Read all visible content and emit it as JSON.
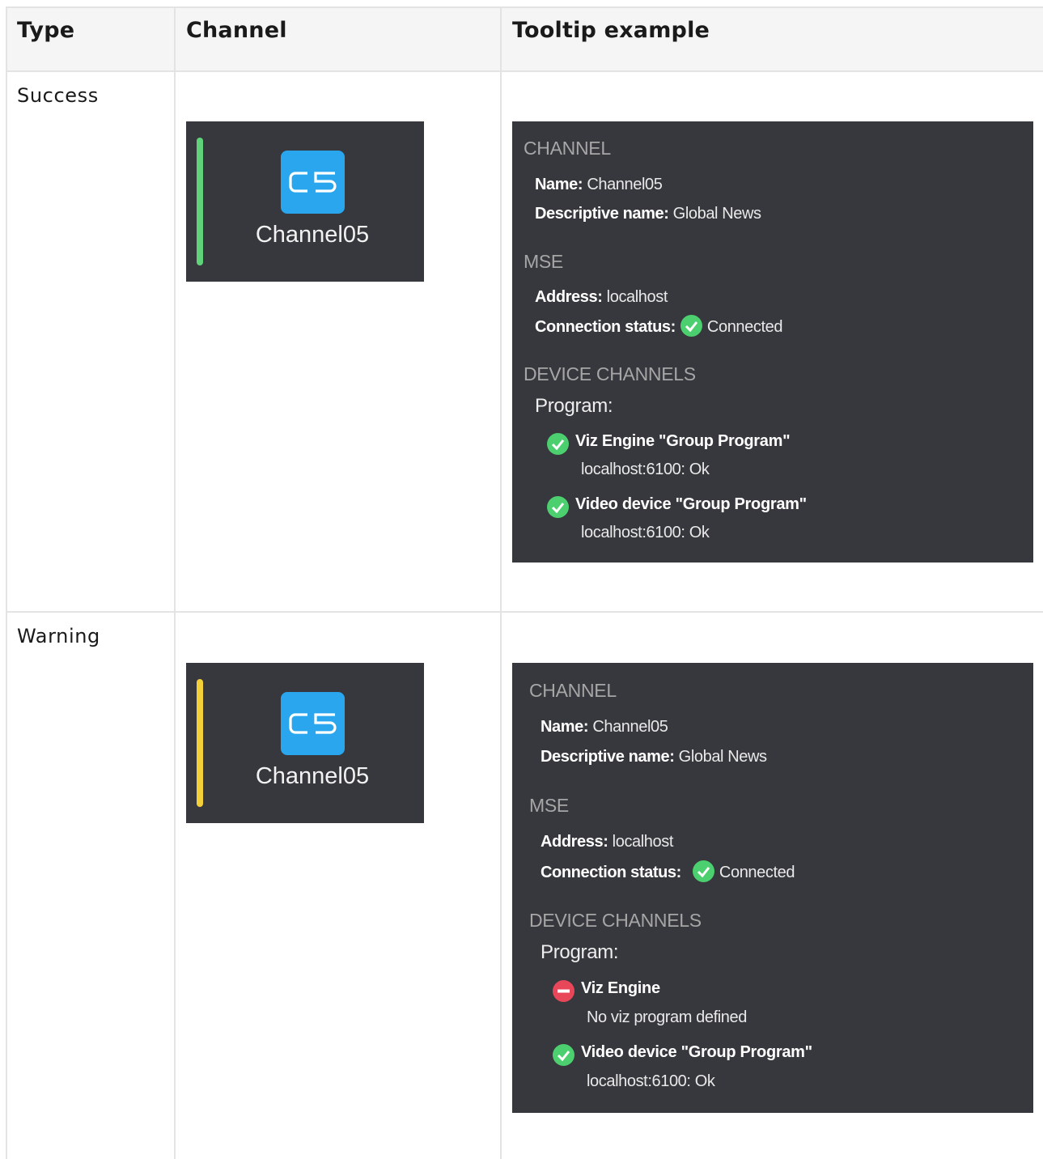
{
  "header": {
    "type": "Type",
    "channel": "Channel",
    "tooltip": "Tooltip example"
  },
  "rows": [
    {
      "type": "Success",
      "card": {
        "icon_text": "C5",
        "name": "Channel05",
        "status_color": "#5fd27a"
      },
      "tooltip": {
        "channel_heading": "CHANNEL",
        "name_label": "Name:",
        "name_value": "Channel05",
        "desc_label": "Descriptive name:",
        "desc_value": "Global News",
        "mse_heading": "MSE",
        "address_label": "Address:",
        "address_value": "localhost",
        "conn_label": "Connection status:",
        "conn_value": "Connected",
        "devices_heading": "DEVICE CHANNELS",
        "program_label": "Program:",
        "devices": [
          {
            "status": "ok",
            "title": "Viz Engine \"Group Program\"",
            "detail": "localhost:6100: Ok"
          },
          {
            "status": "ok",
            "title": "Video device \"Group Program\"",
            "detail": "localhost:6100: Ok"
          }
        ]
      }
    },
    {
      "type": "Warning",
      "card": {
        "icon_text": "C5",
        "name": "Channel05",
        "status_color": "#f3cf3a"
      },
      "tooltip": {
        "channel_heading": "CHANNEL",
        "name_label": "Name:",
        "name_value": "Channel05",
        "desc_label": "Descriptive name:",
        "desc_value": "Global News",
        "mse_heading": "MSE",
        "address_label": "Address:",
        "address_value": "localhost",
        "conn_label": "Connection status:",
        "conn_value": "Connected",
        "devices_heading": "DEVICE CHANNELS",
        "program_label": "Program:",
        "devices": [
          {
            "status": "error",
            "title": "Viz Engine",
            "detail": "No viz program defined"
          },
          {
            "status": "ok",
            "title": "Video device \"Group Program\"",
            "detail": "localhost:6100: Ok"
          }
        ]
      }
    }
  ],
  "colors": {
    "ok_icon": "#4ccf6e",
    "error_icon": "#e8475a",
    "channel_icon": "#2aa6ee",
    "panel_bg": "#36383d"
  },
  "icons": {
    "ok": "check-circle-icon",
    "error": "minus-circle-icon"
  }
}
